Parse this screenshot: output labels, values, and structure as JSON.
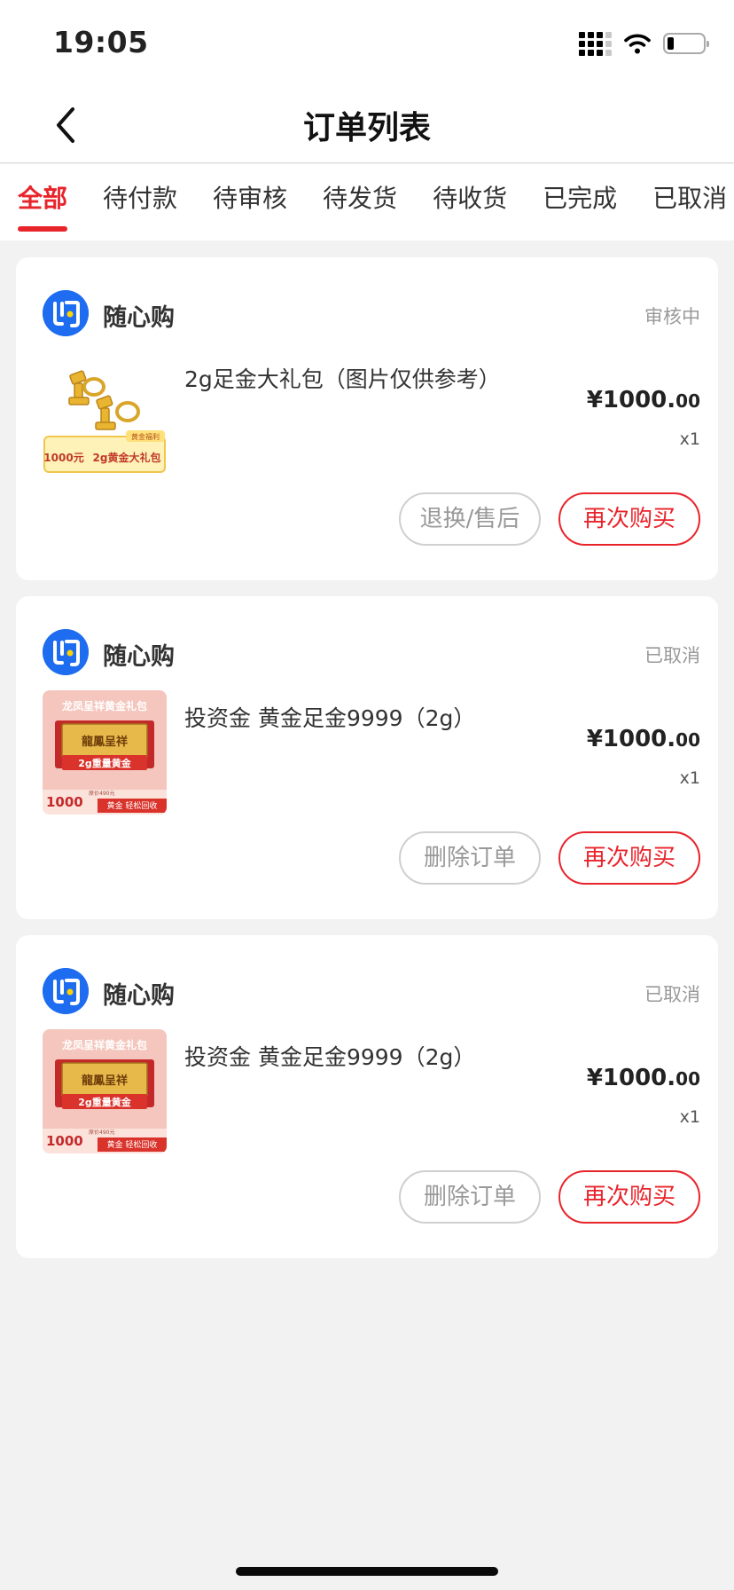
{
  "status_bar": {
    "time": "19:05",
    "battery_level": 0.18
  },
  "header": {
    "title": "订单列表",
    "back_icon": "chevron-left-icon"
  },
  "tabs": [
    {
      "label": "全部",
      "active": true
    },
    {
      "label": "待付款",
      "active": false
    },
    {
      "label": "待审核",
      "active": false
    },
    {
      "label": "待发货",
      "active": false
    },
    {
      "label": "待收货",
      "active": false
    },
    {
      "label": "已完成",
      "active": false
    },
    {
      "label": "已取消",
      "active": false
    }
  ],
  "colors": {
    "accent": "#e8242b",
    "shop_logo": "#1e6cf0",
    "background": "#f2f2f2"
  },
  "orders": [
    {
      "shop_name": "随心购",
      "status": "审核中",
      "product_name": "2g足金大礼包（图片仅供参考）",
      "price_main": "¥1000.",
      "price_cents": "00",
      "quantity": "x1",
      "thumb_texts": [
        "黄金福利",
        "1000元",
        "2g黄金大礼包"
      ],
      "buttons": [
        "退换/售后",
        "再次购买"
      ]
    },
    {
      "shop_name": "随心购",
      "status": "已取消",
      "product_name": "投资金 黄金足金9999（2g）",
      "price_main": "¥1000.",
      "price_cents": "00",
      "quantity": "x1",
      "thumb_texts": [
        "龙凤呈祥黄金礼包",
        "龍鳳呈祥",
        "2g重量黄金",
        "1000",
        "原价490元",
        "黄金 轻松回收"
      ],
      "buttons": [
        "删除订单",
        "再次购买"
      ]
    },
    {
      "shop_name": "随心购",
      "status": "已取消",
      "product_name": "投资金 黄金足金9999（2g）",
      "price_main": "¥1000.",
      "price_cents": "00",
      "quantity": "x1",
      "thumb_texts": [
        "龙凤呈祥黄金礼包",
        "龍鳳呈祥",
        "2g重量黄金",
        "1000",
        "原价490元",
        "黄金 轻松回收"
      ],
      "buttons": [
        "删除订单",
        "再次购买"
      ]
    }
  ]
}
